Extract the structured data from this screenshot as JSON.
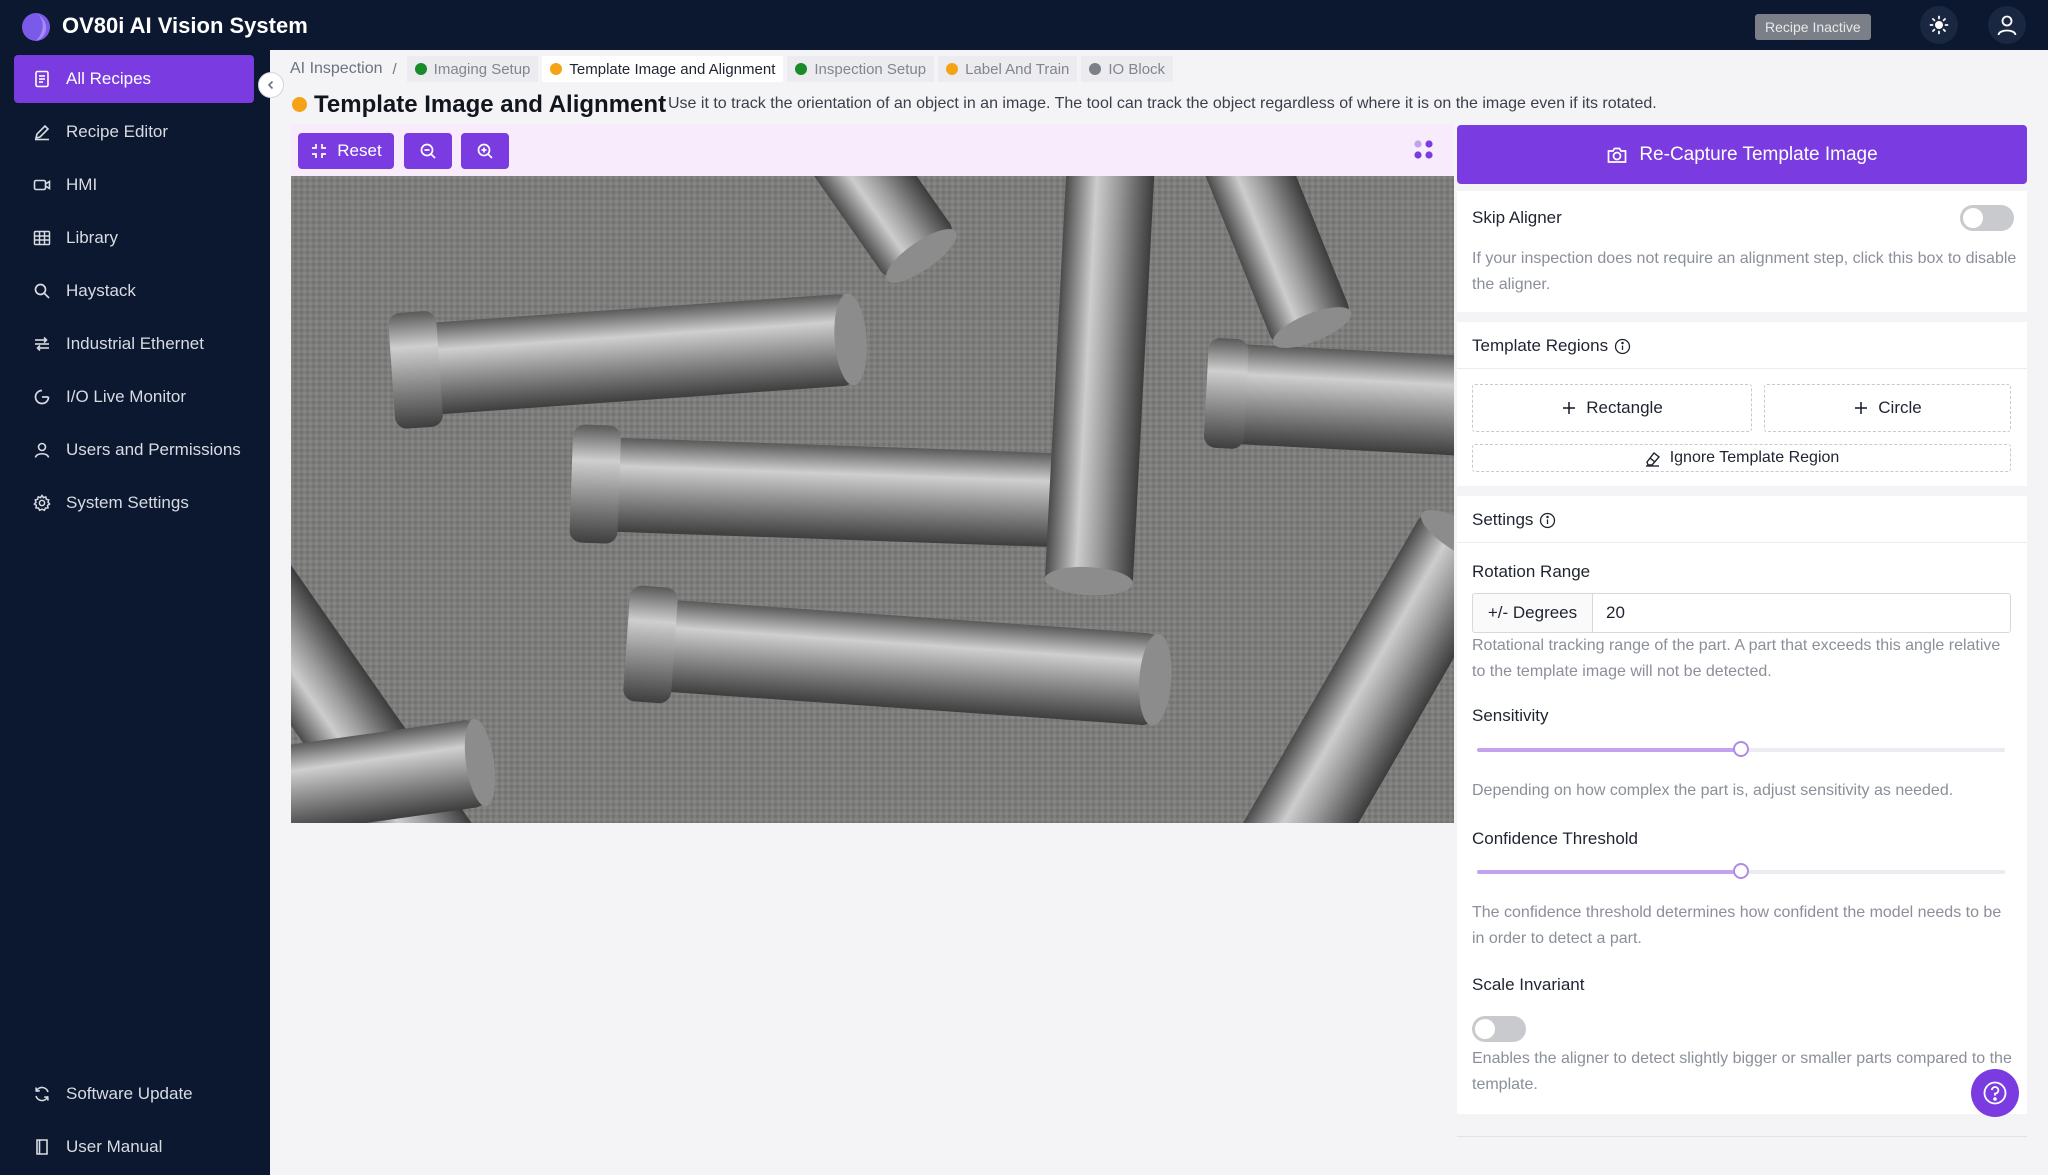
{
  "app": {
    "title": "OV80i AI Vision System",
    "status_badge": "Recipe Inactive"
  },
  "sidebar": {
    "items": [
      {
        "label": "All Recipes",
        "icon": "document-icon",
        "active": true
      },
      {
        "label": "Recipe Editor",
        "icon": "pencil-icon"
      },
      {
        "label": "HMI",
        "icon": "video-icon"
      },
      {
        "label": "Library",
        "icon": "grid-icon"
      },
      {
        "label": "Haystack",
        "icon": "search-icon"
      },
      {
        "label": "Industrial Ethernet",
        "icon": "network-icon"
      },
      {
        "label": "I/O Live Monitor",
        "icon": "gauge-icon"
      },
      {
        "label": "Users and Permissions",
        "icon": "user-icon"
      },
      {
        "label": "System Settings",
        "icon": "gear-icon"
      }
    ],
    "footer": [
      {
        "label": "Software Update",
        "icon": "refresh-icon"
      },
      {
        "label": "User Manual",
        "icon": "book-icon"
      }
    ]
  },
  "breadcrumb": {
    "root": "AI Inspection",
    "separator": "/",
    "tabs": [
      {
        "label": "Imaging Setup",
        "color": "#1a8a2a"
      },
      {
        "label": "Template Image and Alignment",
        "color": "#f5a316",
        "active": true
      },
      {
        "label": "Inspection Setup",
        "color": "#1a8a2a"
      },
      {
        "label": "Label And Train",
        "color": "#f5a316"
      },
      {
        "label": "IO Block",
        "color": "#7b7f88"
      }
    ]
  },
  "page": {
    "title": "Template Image and Alignment",
    "description": "Use it to track the orientation of an object in an image. The tool can track the object regardless of where it is on the image even if its rotated."
  },
  "toolbar": {
    "reset_label": "Reset"
  },
  "panel": {
    "recapture_label": "Re-Capture Template Image",
    "skip_aligner": {
      "title": "Skip Aligner",
      "enabled": false,
      "help": "If your inspection does not require an alignment step, click this box to disable the aligner."
    },
    "template_regions": {
      "title": "Template Regions",
      "rectangle_label": "Rectangle",
      "circle_label": "Circle",
      "ignore_label": "Ignore Template Region"
    },
    "settings": {
      "title": "Settings",
      "rotation_label": "Rotation Range",
      "rotation_addon": "+/- Degrees",
      "rotation_value": "20",
      "rotation_help": "Rotational tracking range of the part. A part that exceeds this angle relative to the template image will not be detected.",
      "sensitivity_label": "Sensitivity",
      "sensitivity_value": 0.5,
      "sensitivity_help": "Depending on how complex the part is, adjust sensitivity as needed.",
      "confidence_label": "Confidence Threshold",
      "confidence_value": 0.5,
      "confidence_help": "The confidence threshold determines how confident the model needs to be in order to detect a part.",
      "scale_label": "Scale Invariant",
      "scale_enabled": false,
      "scale_help": "Enables the aligner to detect slightly bigger or smaller parts compared to the template."
    }
  },
  "colors": {
    "accent": "#7a3ce0",
    "nav_bg": "#0b1830",
    "pending": "#f5a316",
    "done": "#1a8a2a"
  }
}
